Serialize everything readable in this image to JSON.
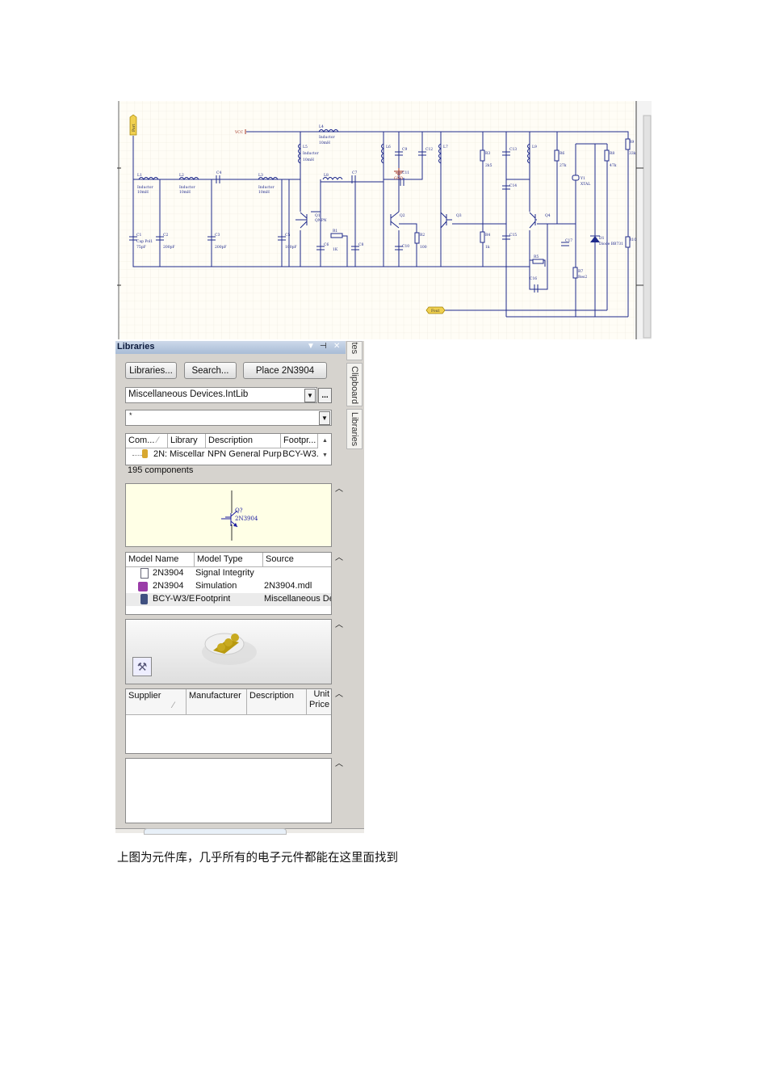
{
  "schematic": {
    "ports": {
      "left": "Port",
      "out": "Fout"
    },
    "power": {
      "vcc": "VCC",
      "gnd": "GND"
    },
    "labels": [
      "L1",
      "Inductor",
      "10mH",
      "L2",
      "L3",
      "L5",
      "L4",
      "L6",
      "L7",
      "L8",
      "L9",
      "C4",
      "C7",
      "C1",
      "C2",
      "C3",
      "C5",
      "C6",
      "C8",
      "C9",
      "C10",
      "C11",
      "C12",
      "C13",
      "C14",
      "C15",
      "C16",
      "C17",
      "Q1",
      "Q2",
      "Q3",
      "Q4",
      "R1",
      "R2",
      "R3",
      "R4",
      "R5",
      "R6",
      "R7",
      "R8",
      "R9",
      "R10",
      "Y1",
      "XTAL",
      "D1",
      "Diode BB731",
      "QNPN",
      "Cap Pol1",
      "Res2"
    ],
    "values": [
      "10mH",
      "75pF",
      "200pF",
      "100pF",
      "2k5",
      "27k",
      "47k",
      "33k",
      "1k",
      "100",
      "1K"
    ]
  },
  "panel": {
    "title": "Libraries",
    "buttons": {
      "libraries": "Libraries...",
      "search": "Search...",
      "place": "Place 2N3904"
    },
    "library_select": "Miscellaneous Devices.IntLib",
    "more_btn": "...",
    "filter_value": "*",
    "components": {
      "headers": [
        "Com...",
        "Library",
        "Description",
        "Footpr..."
      ],
      "rows": [
        [
          "2N:",
          "Miscellar",
          "NPN General Purp",
          "BCY-W3."
        ]
      ],
      "count": "195 components"
    },
    "preview": {
      "designator": "Q?",
      "part": "2N3904"
    },
    "models": {
      "headers": [
        "Model Name",
        "Model Type",
        "Source"
      ],
      "rows": [
        [
          "2N3904",
          "Signal Integrity",
          ""
        ],
        [
          "2N3904",
          "Simulation",
          "2N3904.mdl"
        ],
        [
          "BCY-W3/E",
          "Footprint",
          "Miscellaneous De"
        ]
      ]
    },
    "supplier": {
      "headers": [
        "Supplier",
        "Manufacturer",
        "Description",
        "Unit Price"
      ]
    },
    "side_tabs": [
      "ites",
      "Clipboard",
      "Libraries"
    ]
  },
  "caption": "上图为元件库，几乎所有的电子元件都能在这里面找到"
}
